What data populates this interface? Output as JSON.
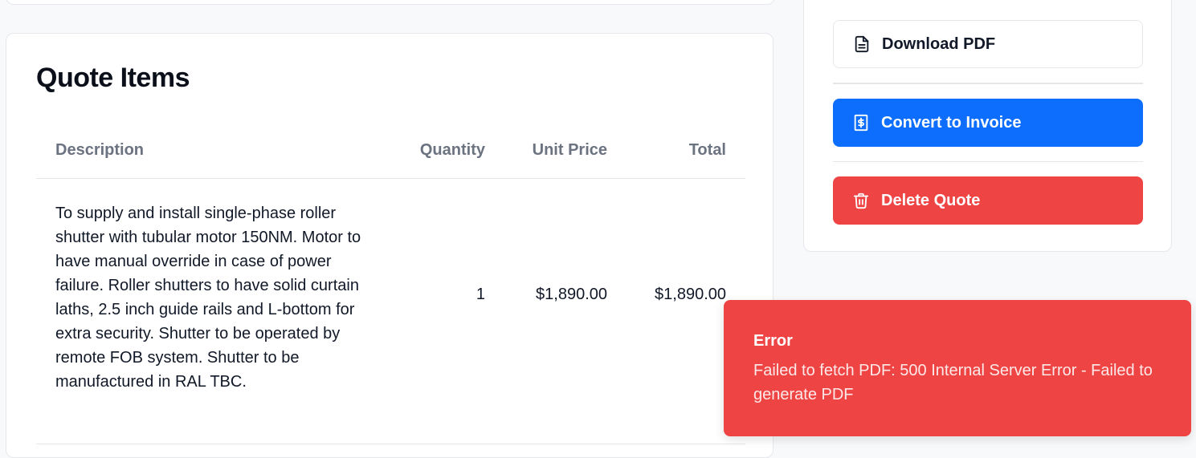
{
  "quote_items": {
    "title": "Quote Items",
    "columns": [
      "Description",
      "Quantity",
      "Unit Price",
      "Total"
    ],
    "rows": [
      {
        "description": "To supply and install single-phase roller shutter with tubular motor 150NM. Motor to have manual override in case of power failure. Roller shutters to have solid curtain laths, 2.5 inch guide rails and L-bottom for extra security. Shutter to be operated by remote FOB system. Shutter to be manufactured in RAL TBC.",
        "quantity": "1",
        "unit_price": "$1,890.00",
        "total": "$1,890.00"
      }
    ]
  },
  "actions": {
    "download_pdf": "Download PDF",
    "convert_to_invoice": "Convert to Invoice",
    "delete_quote": "Delete Quote"
  },
  "toast": {
    "title": "Error",
    "message": "Failed to fetch PDF: 500 Internal Server Error - Failed to generate PDF"
  },
  "colors": {
    "primary": "#0d6efd",
    "danger": "#ef4444"
  },
  "icons": {
    "download": "file-icon",
    "convert": "receipt-dollar-icon",
    "delete": "trash-icon"
  }
}
